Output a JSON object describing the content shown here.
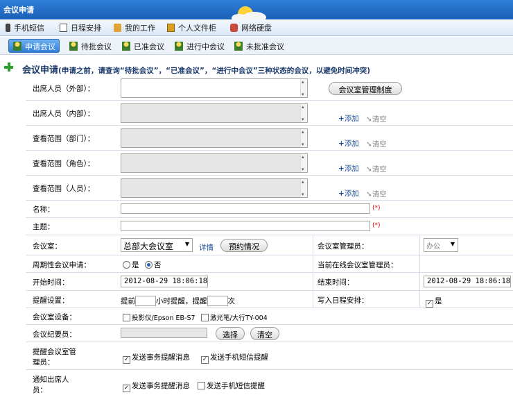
{
  "window": {
    "title": "会议申请"
  },
  "topnav": [
    {
      "label": "手机短信",
      "icon": "phone-icon"
    },
    {
      "label": "日程安排",
      "icon": "calendar-icon"
    },
    {
      "label": "我的工作",
      "icon": "home-icon"
    },
    {
      "label": "个人文件柜",
      "icon": "folder-icon"
    },
    {
      "label": "网络硬盘",
      "icon": "disk-icon"
    }
  ],
  "subtabs": [
    {
      "label": "申请会议",
      "active": true
    },
    {
      "label": "待批会议",
      "active": false
    },
    {
      "label": "已准会议",
      "active": false
    },
    {
      "label": "进行中会议",
      "active": false
    },
    {
      "label": "未批准会议",
      "active": false
    }
  ],
  "page": {
    "title": "会议申请",
    "note": "(申请之前，请查询“待批会议”，“已准会议”，“进行中会议”三种状态的会议，以避免时间冲突)"
  },
  "form": {
    "attendees_external": {
      "label": "出席人员（外部）：",
      "value": ""
    },
    "room_rules_button": "会议室管理制度",
    "attendees_internal": {
      "label": "出席人员（内部）："
    },
    "scope_dept": {
      "label": "查看范围（部门）："
    },
    "scope_role": {
      "label": "查看范围（角色）："
    },
    "scope_user": {
      "label": "查看范围（人员）："
    },
    "add_label": "添加",
    "add_plus": "+",
    "clear_label": "清空",
    "name": {
      "label": "名称：",
      "value": "",
      "required": "(*)"
    },
    "subject": {
      "label": "主题：",
      "value": "",
      "required": "(*)"
    },
    "room": {
      "label": "会议室：",
      "selected": "总部大会议室",
      "detail_link": "详情",
      "booking_button": "预约情况"
    },
    "room_manager": {
      "label": "会议室管理员：",
      "selected": "办公"
    },
    "periodic": {
      "label": "周期性会议申请：",
      "options": [
        "是",
        "否"
      ],
      "selected": "否"
    },
    "online_managers": {
      "label": "当前在线会议室管理员："
    },
    "start_time": {
      "label": "开始时间：",
      "value": "2012-08-29 18:06:18"
    },
    "end_time": {
      "label": "结束时间：",
      "value": "2012-08-29 18:06:18"
    },
    "reminder": {
      "label": "提醒设置：",
      "prefix": "提前",
      "hours_suffix": "小时提醒，提醒",
      "times_suffix": "次"
    },
    "write_schedule": {
      "label": "写入日程安排：",
      "checkbox_label": "是",
      "checked": true
    },
    "equipment": {
      "label": "会议室设备：",
      "items": [
        "投影仪/Epson EB-S7",
        "激光笔/大行TY-004"
      ]
    },
    "recorder": {
      "label": "会议纪要员：",
      "select_button": "选择",
      "clear_button": "清空"
    },
    "remind_manager": {
      "label_line1": "提醒会议室管",
      "label_line2": "理员：",
      "options": [
        {
          "label": "发送事务提醒消息",
          "checked": true
        },
        {
          "label": "发送手机短信提醒",
          "checked": true
        }
      ]
    },
    "notify_attendees": {
      "label_line1": "通知出席人",
      "label_line2": "员：",
      "options": [
        {
          "label": "发送事务提醒消息",
          "checked": true
        },
        {
          "label": "发送手机短信提醒",
          "checked": false
        }
      ]
    }
  }
}
